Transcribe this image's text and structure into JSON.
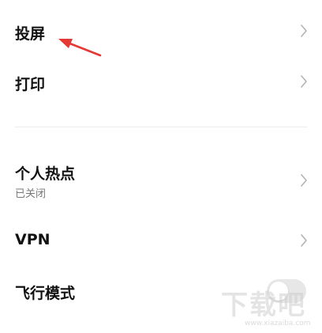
{
  "settings": {
    "items": [
      {
        "label": "投屏"
      },
      {
        "label": "打印"
      },
      {
        "label": "个人热点",
        "sublabel": "已关闭"
      },
      {
        "label": "VPN"
      },
      {
        "label": "飞行模式",
        "toggle_on": false
      }
    ]
  },
  "annotation": {
    "arrow_color": "#e53935"
  },
  "watermark": {
    "logo_text": "下载吧",
    "url": "www.xiazaiba.com"
  },
  "icons": {
    "chevron": "chevron-right-icon",
    "arrow": "red-arrow-icon"
  }
}
